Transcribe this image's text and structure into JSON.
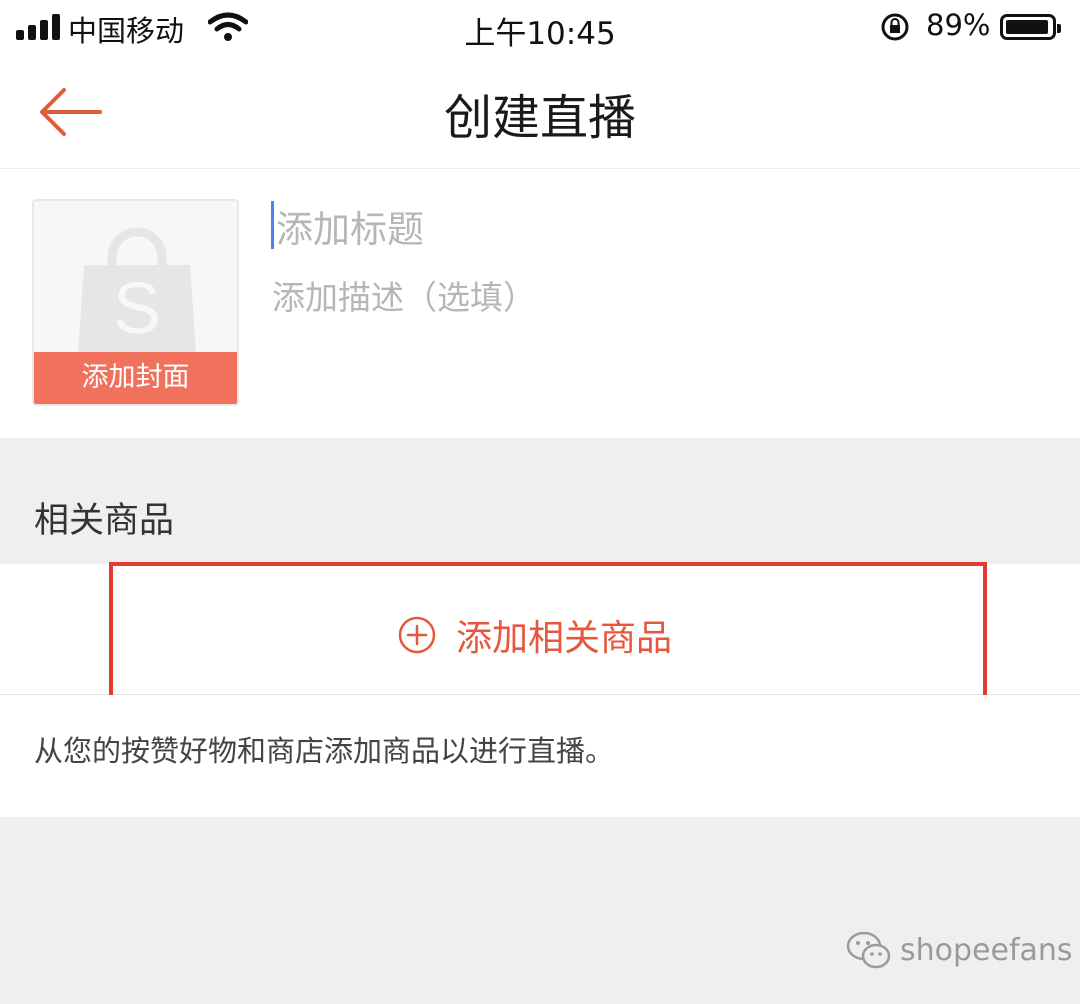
{
  "status_bar": {
    "carrier": "中国移动",
    "time": "上午10:45",
    "battery_percent": "89%",
    "battery_level": 0.89
  },
  "header": {
    "title": "创建直播",
    "back_icon": "arrow-left-icon"
  },
  "form": {
    "cover_label": "添加封面",
    "cover_placeholder_icon": "shopee-bag-icon",
    "title_placeholder": "添加标题",
    "description_placeholder": "添加描述（选填）"
  },
  "related_products": {
    "section_title": "相关商品",
    "add_button_label": "添加相关商品",
    "add_icon": "plus-circle-icon",
    "hint": "从您的按赞好物和商店添加商品以进行直播。"
  },
  "watermark": {
    "text": "shopeefans",
    "icon": "wechat-icon"
  },
  "colors": {
    "accent": "#e6573d",
    "cover_label_bg": "#f0725c",
    "highlight_frame": "#e23b2f",
    "page_background": "#efeff1"
  }
}
